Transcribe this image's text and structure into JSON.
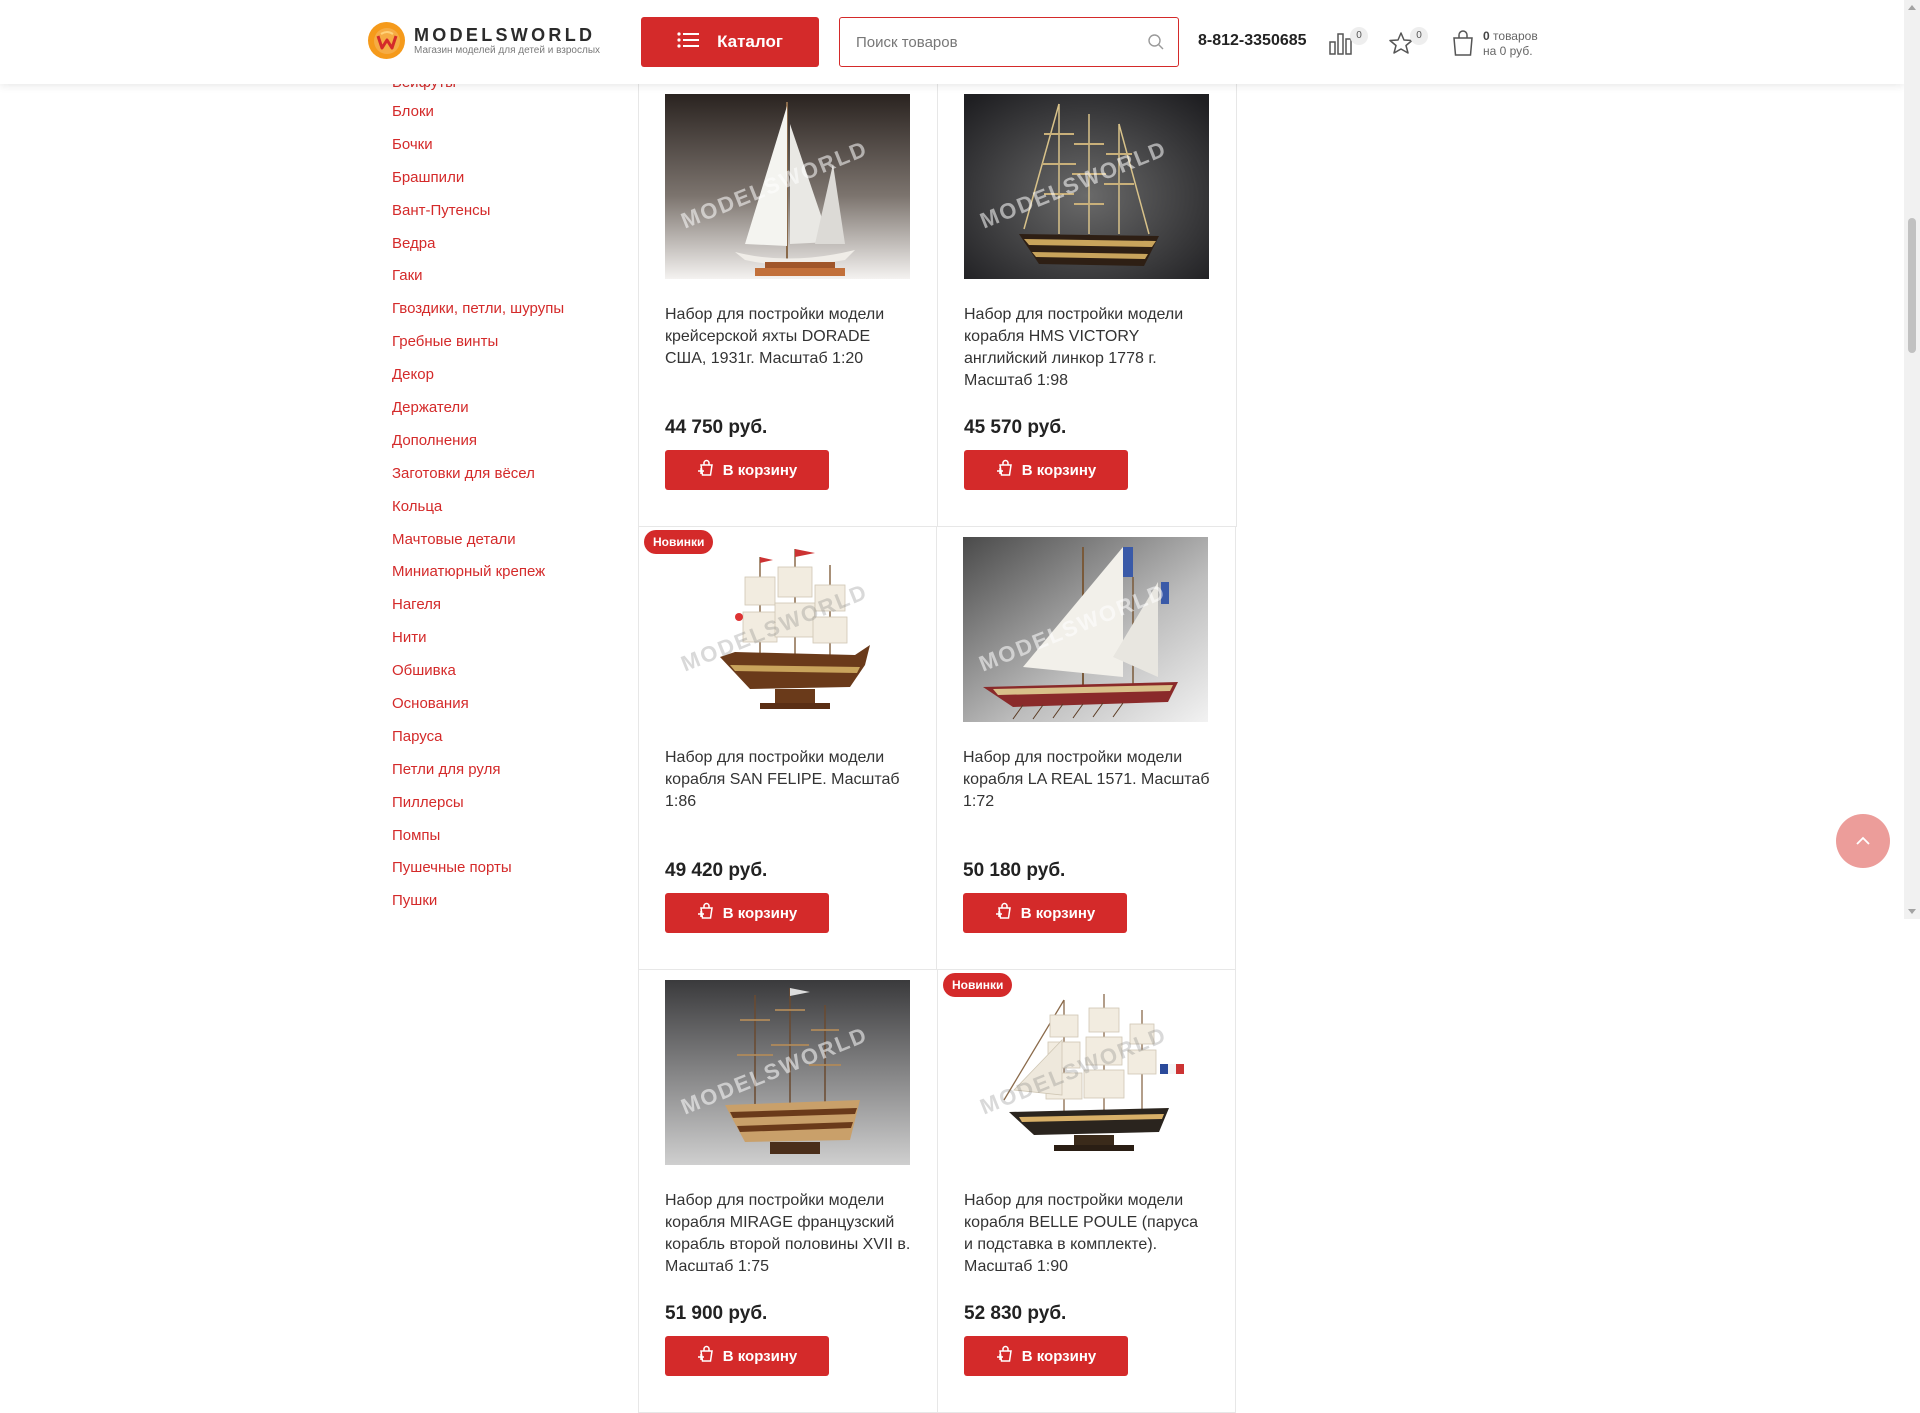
{
  "header": {
    "logo_name": "MODELSWORLD",
    "logo_tagline": "Магазин моделей для детей и взрослых",
    "catalog_label": "Каталог",
    "search_placeholder": "Поиск товаров",
    "phone": "8-812-3350685",
    "compare_count": "0",
    "favorites_count": "0",
    "cart_items": "0",
    "cart_items_label": "товаров",
    "cart_total": "на 0 руб."
  },
  "sidebar": {
    "items": [
      "Бейфуты",
      "Блоки",
      "Бочки",
      "Брашпили",
      "Вант-Путенсы",
      "Ведра",
      "Гаки",
      "Гвоздики, петли, шурупы",
      "Гребные винты",
      "Декор",
      "Держатели",
      "Дополнения",
      "Заготовки для вёсел",
      "Кольца",
      "Мачтовые детали",
      "Миниатюрный крепеж",
      "Нагеля",
      "Нити",
      "Обшивка",
      "Основания",
      "Паруса",
      "Петли для руля",
      "Пиллерсы",
      "Помпы",
      "Пушечные порты",
      "Пушки"
    ]
  },
  "products": [
    {
      "title": "Набор для постройки модели крейсерской яхты DORADE США, 1931г. Масштаб 1:20",
      "price": "44 750 руб.",
      "badge": "",
      "button": "В корзину",
      "image": "sailing-yacht"
    },
    {
      "title": "Набор для постройки модели корабля HMS VICTORY английский линкор 1778 г. Масштаб 1:98",
      "price": "45 570 руб.",
      "badge": "",
      "button": "В корзину",
      "image": "ship-of-the-line"
    },
    {
      "title": "Набор для постройки модели корабля SAN FELIPE. Масштаб 1:86",
      "price": "49 420 руб.",
      "badge": "Новинки",
      "button": "В корзину",
      "image": "galleon"
    },
    {
      "title": "Набор для постройки модели корабля LA REAL 1571. Масштаб 1:72",
      "price": "50 180 руб.",
      "badge": "",
      "button": "В корзину",
      "image": "galley"
    },
    {
      "title": "Набор для постройки модели корабля MIRAGE французский корабль второй половины XVII в. Масштаб 1:75",
      "price": "51 900 руб.",
      "badge": "",
      "button": "В корзину",
      "image": "warship"
    },
    {
      "title": "Набор для постройки модели корабля BELLE POULE (паруса и подставка в комплекте). Масштаб 1:90",
      "price": "52 830 руб.",
      "badge": "Новинки",
      "button": "В корзину",
      "image": "frigate"
    }
  ],
  "watermark": "MODELSWORLD",
  "colors": {
    "accent": "#d42a2a",
    "logo": "#f59a1b",
    "to_top": "#ec9d9a"
  }
}
